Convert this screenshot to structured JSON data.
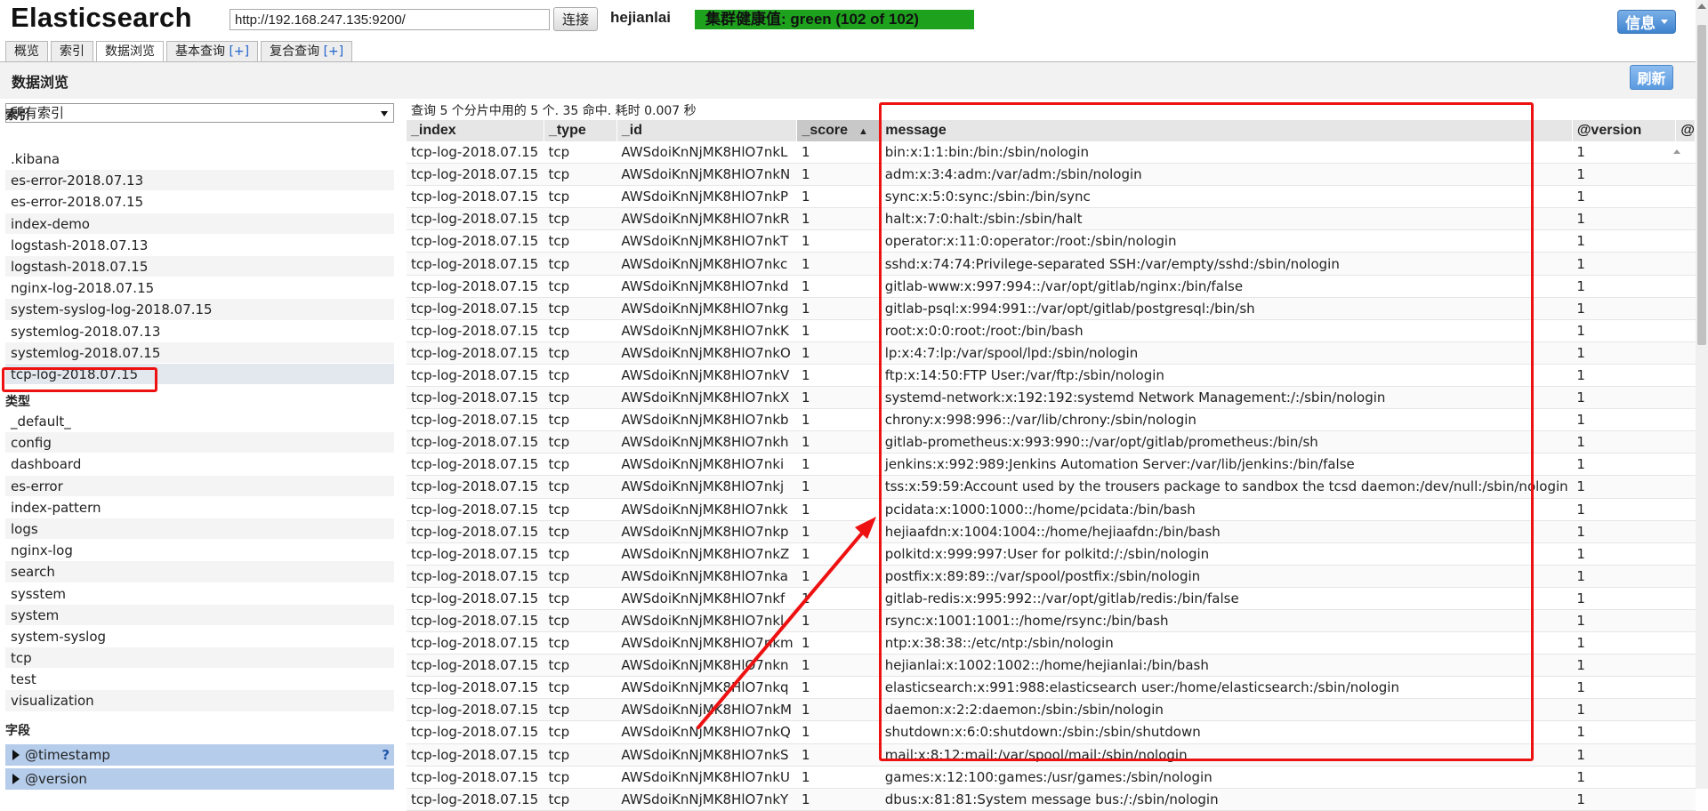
{
  "header": {
    "app_title": "Elasticsearch",
    "url_value": "http://192.168.247.135:9200/",
    "connect_label": "连接",
    "cluster_name": "hejianlai",
    "health_text": "集群健康值: green (102 of 102)",
    "info_label": "信息",
    "health_color": "#1ea21e"
  },
  "tabs": [
    {
      "label": "概览",
      "plus": ""
    },
    {
      "label": "索引",
      "plus": ""
    },
    {
      "label": "数据浏览",
      "plus": ""
    },
    {
      "label": "基本查询 ",
      "plus": "[+]"
    },
    {
      "label": "复合查询 ",
      "plus": "[+]"
    }
  ],
  "page": {
    "title": "数据浏览",
    "refresh_label": "刷新"
  },
  "sidebar": {
    "index_select_value": "所有索引",
    "indices_heading": "索引",
    "indices": [
      ".kibana",
      "es-error-2018.07.13",
      "es-error-2018.07.15",
      "index-demo",
      "logstash-2018.07.13",
      "logstash-2018.07.15",
      "nginx-log-2018.07.15",
      "system-syslog-log-2018.07.15",
      "systemlog-2018.07.13",
      "systemlog-2018.07.15",
      "tcp-log-2018.07.15"
    ],
    "types_heading": "类型",
    "types": [
      "_default_",
      "config",
      "dashboard",
      "es-error",
      "index-pattern",
      "logs",
      "nginx-log",
      "search",
      "sysstem",
      "system",
      "system-syslog",
      "tcp",
      "test",
      "visualization"
    ],
    "fields_heading": "字段",
    "fields": [
      "@timestamp",
      "@version"
    ],
    "field_help": "?"
  },
  "results": {
    "query_info": "查询 5 个分片中用的 5 个. 35 命中. 耗时 0.007 秒",
    "columns": [
      "_index",
      "_type",
      "_id",
      "_score",
      "message",
      "@version",
      "@"
    ],
    "sort_indicator": "▲",
    "rows": [
      [
        "tcp-log-2018.07.15",
        "tcp",
        "AWSdoiKnNjMK8HlO7nkL",
        "1",
        "bin:x:1:1:bin:/bin:/sbin/nologin",
        "1"
      ],
      [
        "tcp-log-2018.07.15",
        "tcp",
        "AWSdoiKnNjMK8HlO7nkN",
        "1",
        "adm:x:3:4:adm:/var/adm:/sbin/nologin",
        "1"
      ],
      [
        "tcp-log-2018.07.15",
        "tcp",
        "AWSdoiKnNjMK8HlO7nkP",
        "1",
        "sync:x:5:0:sync:/sbin:/bin/sync",
        "1"
      ],
      [
        "tcp-log-2018.07.15",
        "tcp",
        "AWSdoiKnNjMK8HlO7nkR",
        "1",
        "halt:x:7:0:halt:/sbin:/sbin/halt",
        "1"
      ],
      [
        "tcp-log-2018.07.15",
        "tcp",
        "AWSdoiKnNjMK8HlO7nkT",
        "1",
        "operator:x:11:0:operator:/root:/sbin/nologin",
        "1"
      ],
      [
        "tcp-log-2018.07.15",
        "tcp",
        "AWSdoiKnNjMK8HlO7nkc",
        "1",
        "sshd:x:74:74:Privilege-separated SSH:/var/empty/sshd:/sbin/nologin",
        "1"
      ],
      [
        "tcp-log-2018.07.15",
        "tcp",
        "AWSdoiKnNjMK8HlO7nkd",
        "1",
        "gitlab-www:x:997:994::/var/opt/gitlab/nginx:/bin/false",
        "1"
      ],
      [
        "tcp-log-2018.07.15",
        "tcp",
        "AWSdoiKnNjMK8HlO7nkg",
        "1",
        "gitlab-psql:x:994:991::/var/opt/gitlab/postgresql:/bin/sh",
        "1"
      ],
      [
        "tcp-log-2018.07.15",
        "tcp",
        "AWSdoiKnNjMK8HlO7nkK",
        "1",
        "root:x:0:0:root:/root:/bin/bash",
        "1"
      ],
      [
        "tcp-log-2018.07.15",
        "tcp",
        "AWSdoiKnNjMK8HlO7nkO",
        "1",
        "lp:x:4:7:lp:/var/spool/lpd:/sbin/nologin",
        "1"
      ],
      [
        "tcp-log-2018.07.15",
        "tcp",
        "AWSdoiKnNjMK8HlO7nkV",
        "1",
        "ftp:x:14:50:FTP User:/var/ftp:/sbin/nologin",
        "1"
      ],
      [
        "tcp-log-2018.07.15",
        "tcp",
        "AWSdoiKnNjMK8HlO7nkX",
        "1",
        "systemd-network:x:192:192:systemd Network Management:/:/sbin/nologin",
        "1"
      ],
      [
        "tcp-log-2018.07.15",
        "tcp",
        "AWSdoiKnNjMK8HlO7nkb",
        "1",
        "chrony:x:998:996::/var/lib/chrony:/sbin/nologin",
        "1"
      ],
      [
        "tcp-log-2018.07.15",
        "tcp",
        "AWSdoiKnNjMK8HlO7nkh",
        "1",
        "gitlab-prometheus:x:993:990::/var/opt/gitlab/prometheus:/bin/sh",
        "1"
      ],
      [
        "tcp-log-2018.07.15",
        "tcp",
        "AWSdoiKnNjMK8HlO7nki",
        "1",
        "jenkins:x:992:989:Jenkins Automation Server:/var/lib/jenkins:/bin/false",
        "1"
      ],
      [
        "tcp-log-2018.07.15",
        "tcp",
        "AWSdoiKnNjMK8HlO7nkj",
        "1",
        "tss:x:59:59:Account used by the trousers package to sandbox the tcsd daemon:/dev/null:/sbin/nologin",
        "1"
      ],
      [
        "tcp-log-2018.07.15",
        "tcp",
        "AWSdoiKnNjMK8HlO7nkk",
        "1",
        "pcidata:x:1000:1000::/home/pcidata:/bin/bash",
        "1"
      ],
      [
        "tcp-log-2018.07.15",
        "tcp",
        "AWSdoiKnNjMK8HlO7nkp",
        "1",
        "hejiaafdn:x:1004:1004::/home/hejiaafdn:/bin/bash",
        "1"
      ],
      [
        "tcp-log-2018.07.15",
        "tcp",
        "AWSdoiKnNjMK8HlO7nkZ",
        "1",
        "polkitd:x:999:997:User for polkitd:/:/sbin/nologin",
        "1"
      ],
      [
        "tcp-log-2018.07.15",
        "tcp",
        "AWSdoiKnNjMK8HlO7nka",
        "1",
        "postfix:x:89:89::/var/spool/postfix:/sbin/nologin",
        "1"
      ],
      [
        "tcp-log-2018.07.15",
        "tcp",
        "AWSdoiKnNjMK8HlO7nkf",
        "1",
        "gitlab-redis:x:995:992::/var/opt/gitlab/redis:/bin/false",
        "1"
      ],
      [
        "tcp-log-2018.07.15",
        "tcp",
        "AWSdoiKnNjMK8HlO7nkl",
        "1",
        "rsync:x:1001:1001::/home/rsync:/bin/bash",
        "1"
      ],
      [
        "tcp-log-2018.07.15",
        "tcp",
        "AWSdoiKnNjMK8HlO7nkm",
        "1",
        "ntp:x:38:38::/etc/ntp:/sbin/nologin",
        "1"
      ],
      [
        "tcp-log-2018.07.15",
        "tcp",
        "AWSdoiKnNjMK8HlO7nkn",
        "1",
        "hejianlai:x:1002:1002::/home/hejianlai:/bin/bash",
        "1"
      ],
      [
        "tcp-log-2018.07.15",
        "tcp",
        "AWSdoiKnNjMK8HlO7nkq",
        "1",
        "elasticsearch:x:991:988:elasticsearch user:/home/elasticsearch:/sbin/nologin",
        "1"
      ],
      [
        "tcp-log-2018.07.15",
        "tcp",
        "AWSdoiKnNjMK8HlO7nkM",
        "1",
        "daemon:x:2:2:daemon:/sbin:/sbin/nologin",
        "1"
      ],
      [
        "tcp-log-2018.07.15",
        "tcp",
        "AWSdoiKnNjMK8HlO7nkQ",
        "1",
        "shutdown:x:6:0:shutdown:/sbin:/sbin/shutdown",
        "1"
      ],
      [
        "tcp-log-2018.07.15",
        "tcp",
        "AWSdoiKnNjMK8HlO7nkS",
        "1",
        "mail:x:8:12:mail:/var/spool/mail:/sbin/nologin",
        "1"
      ],
      [
        "tcp-log-2018.07.15",
        "tcp",
        "AWSdoiKnNjMK8HlO7nkU",
        "1",
        "games:x:12:100:games:/usr/games:/sbin/nologin",
        "1"
      ],
      [
        "tcp-log-2018.07.15",
        "tcp",
        "AWSdoiKnNjMK8HlO7nkY",
        "1",
        "dbus:x:81:81:System message bus:/:/sbin/nologin",
        "1"
      ]
    ]
  },
  "annotations": {
    "highlight_color": "#ee1111"
  }
}
